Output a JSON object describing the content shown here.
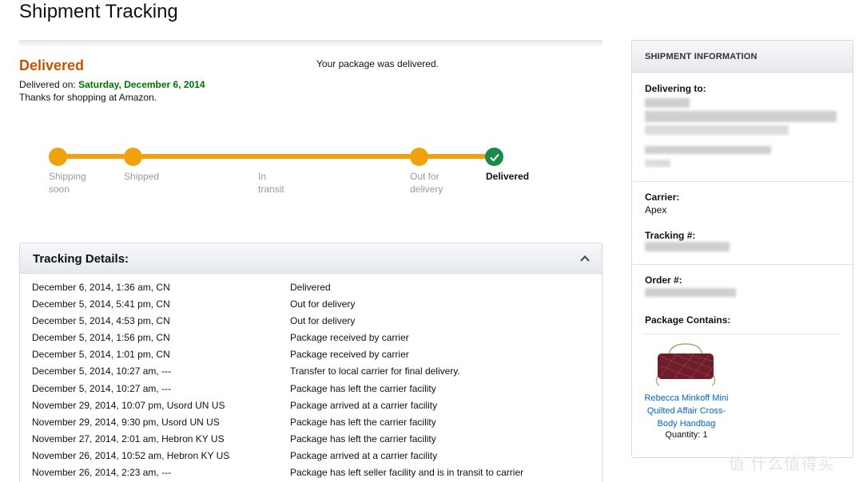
{
  "page": {
    "title": "Shipment Tracking"
  },
  "status": {
    "heading": "Delivered",
    "delivered_on_label": "Delivered on:",
    "delivered_date": "Saturday, December 6, 2014",
    "thanks": "Thanks for shopping at Amazon.",
    "message": "Your package was delivered."
  },
  "progress": {
    "steps": [
      {
        "label": "Shipping soon",
        "state": "done"
      },
      {
        "label": "Shipped",
        "state": "done"
      },
      {
        "label": "In transit",
        "state": "pending"
      },
      {
        "label": "Out for delivery",
        "state": "done"
      },
      {
        "label": "Delivered",
        "state": "current"
      }
    ],
    "bar_color": "#f0a10b",
    "check_color": "#1a8a4b"
  },
  "tracking": {
    "title": "Tracking Details:",
    "rows": [
      {
        "when": "December 6, 2014, 1:36 am,   CN",
        "event": "Delivered"
      },
      {
        "when": "December 5, 2014, 5:41 pm,   CN",
        "event": "Out for delivery"
      },
      {
        "when": "December 5, 2014, 4:53 pm,   CN",
        "event": "Out for delivery"
      },
      {
        "when": "December 5, 2014, 1:56 pm,   CN",
        "event": "Package received by carrier"
      },
      {
        "when": "December 5, 2014, 1:01 pm,   CN",
        "event": "Package received by carrier"
      },
      {
        "when": "December 5, 2014, 10:27 am, ---",
        "event": "Transfer to local carrier for final delivery."
      },
      {
        "when": "December 5, 2014, 10:27 am, ---",
        "event": "Package has left the carrier facility"
      },
      {
        "when": "November 29, 2014, 10:07 pm, Usord UN US",
        "event": "Package arrived at a carrier facility"
      },
      {
        "when": "November 29, 2014, 9:30 pm, Usord UN US",
        "event": "Package has left the carrier facility"
      },
      {
        "when": "November 27, 2014, 2:01 am, Hebron KY US",
        "event": "Package has left the carrier facility"
      },
      {
        "when": "November 26, 2014, 10:52 am, Hebron KY US",
        "event": "Package arrived at a carrier facility"
      },
      {
        "when": "November 26, 2014, 2:23 am, ---",
        "event": "Package has left seller facility and is in transit to carrier"
      }
    ]
  },
  "info": {
    "header": "SHIPMENT INFORMATION",
    "delivering_to_label": "Delivering to:",
    "carrier_label": "Carrier:",
    "carrier_value": "Apex",
    "tracking_label": "Tracking #:",
    "order_label": "Order #:",
    "contains_label": "Package Contains:",
    "product_name": "Rebecca Minkoff Mini Quilted Affair Cross-Body Handbag",
    "product_qty": "Quantity: 1"
  },
  "watermark": "值 什么值得买"
}
